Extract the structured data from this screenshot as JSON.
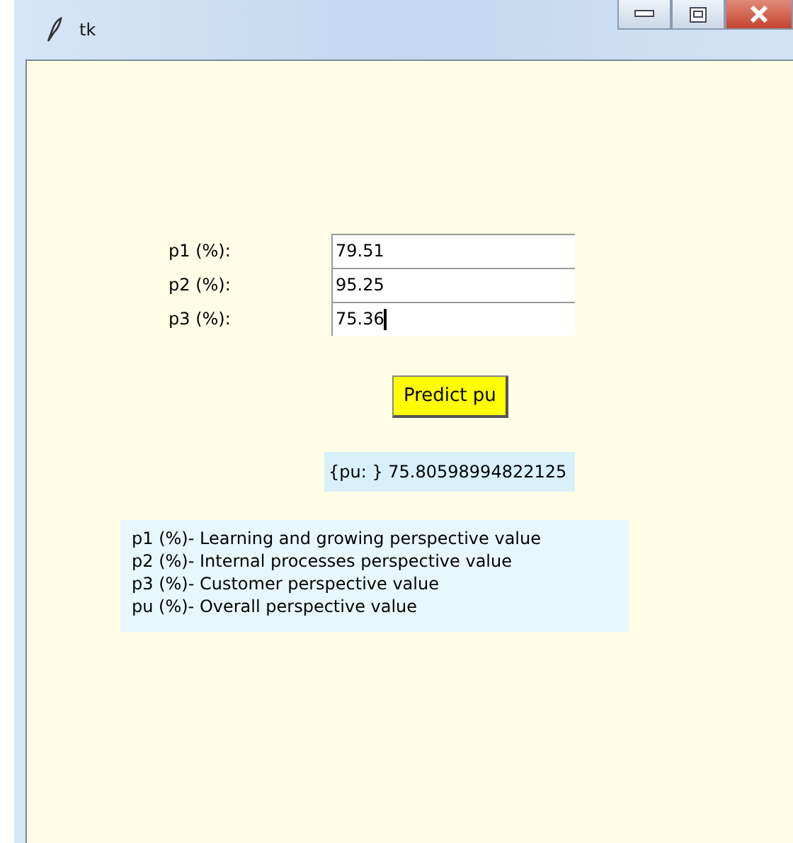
{
  "window": {
    "title": "tk"
  },
  "fields": [
    {
      "label": "p1 (%):",
      "value": "79.51",
      "focused": false
    },
    {
      "label": "p2 (%):",
      "value": "95.25",
      "focused": false
    },
    {
      "label": "p3 (%):",
      "value": "75.36",
      "focused": true
    }
  ],
  "button": "Predict pu",
  "result": "{pu: } 75.80598994822125",
  "legend": [
    "p1 (%)- Learning and growing perspective value",
    "p2 (%)- Internal processes perspective value",
    "p3 (%)- Customer perspective value",
    "pu (%)- Overall perspective value"
  ]
}
